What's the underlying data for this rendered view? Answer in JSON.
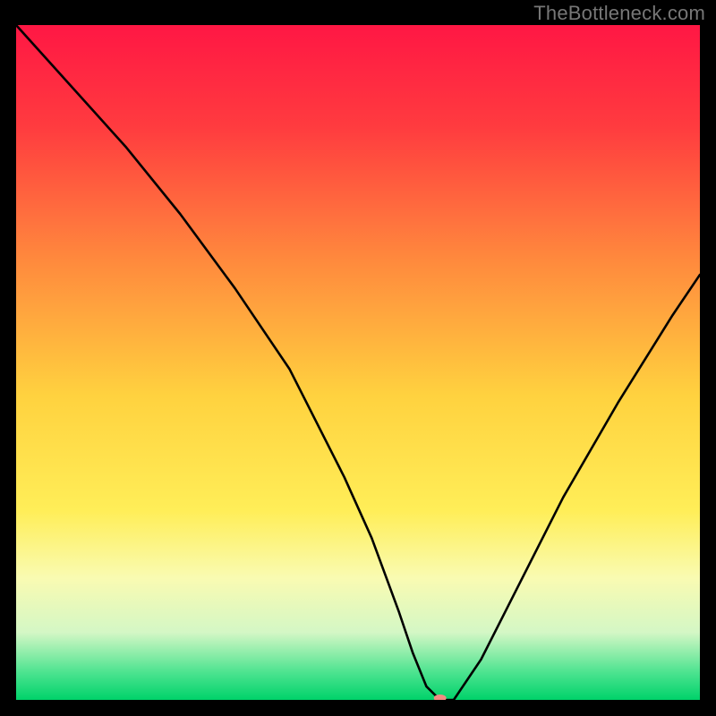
{
  "attribution": "TheBottleneck.com",
  "chart_data": {
    "type": "line",
    "title": "",
    "xlabel": "",
    "ylabel": "",
    "xlim": [
      0,
      100
    ],
    "ylim": [
      0,
      100
    ],
    "series": [
      {
        "name": "bottleneck-curve",
        "x": [
          0,
          8,
          16,
          24,
          32,
          40,
          48,
          52,
          56,
          58,
          60,
          62,
          64,
          68,
          72,
          80,
          88,
          96,
          100
        ],
        "y": [
          100,
          91,
          82,
          72,
          61,
          49,
          33,
          24,
          13,
          7,
          2,
          0,
          0,
          6,
          14,
          30,
          44,
          57,
          63
        ]
      }
    ],
    "marker": {
      "x": 62,
      "y": 0,
      "color": "#f28b82",
      "rx": 7,
      "ry": 4
    },
    "gradient_stops": [
      {
        "offset": 0.0,
        "color": "#ff1744"
      },
      {
        "offset": 0.15,
        "color": "#ff3b3f"
      },
      {
        "offset": 0.35,
        "color": "#ff8a3d"
      },
      {
        "offset": 0.55,
        "color": "#ffd23f"
      },
      {
        "offset": 0.72,
        "color": "#ffee58"
      },
      {
        "offset": 0.82,
        "color": "#f9fbb2"
      },
      {
        "offset": 0.9,
        "color": "#d4f7c5"
      },
      {
        "offset": 0.96,
        "color": "#4be38f"
      },
      {
        "offset": 1.0,
        "color": "#00d26a"
      }
    ],
    "line_color": "#000000",
    "line_width": 2.6
  }
}
